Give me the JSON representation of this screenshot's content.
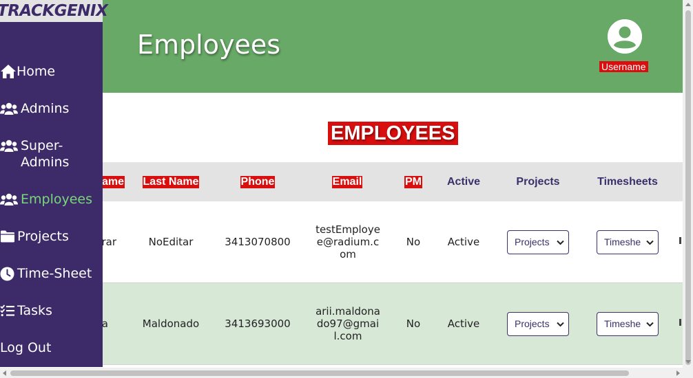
{
  "app": {
    "logo": "TRACKGENIX"
  },
  "header": {
    "title": "Employees",
    "username": "Username"
  },
  "sidebar": {
    "items": [
      {
        "label": "Home",
        "icon": "home-icon"
      },
      {
        "label": "Admins",
        "icon": "users-icon"
      },
      {
        "label": "Super-Admins",
        "icon": "users-icon"
      },
      {
        "label": "Employees",
        "icon": "users-icon",
        "active": true
      },
      {
        "label": "Projects",
        "icon": "folder-icon"
      },
      {
        "label": "Time-Sheet",
        "icon": "clock-icon"
      },
      {
        "label": "Tasks",
        "icon": "tasks-list-icon"
      },
      {
        "label": "Log Out"
      }
    ]
  },
  "main": {
    "section_title": "EMPLOYEES",
    "columns": [
      "ame",
      "Last Name",
      "Phone",
      "Email",
      "PM",
      "Active",
      "Projects",
      "Timesheets"
    ],
    "rows": [
      {
        "name": "rar",
        "last_name": "NoEditar",
        "phone": "3413070800",
        "email": "testEmployee@radium.com",
        "pm": "No",
        "active": "Active",
        "projects": "Projects",
        "timesheets": "Timeshe"
      },
      {
        "name": "a",
        "last_name": "Maldonado",
        "phone": "3413693000",
        "email": "arii.maldonado97@gmail.com",
        "pm": "No",
        "active": "Active",
        "projects": "Projects",
        "timesheets": "Timeshe"
      }
    ]
  },
  "colors": {
    "sidebar": "#3d2b69",
    "header": "#68a967",
    "active_nav": "#7ad67a",
    "label_highlight": "#d90f0f",
    "alt_row": "#d7e8d6"
  }
}
